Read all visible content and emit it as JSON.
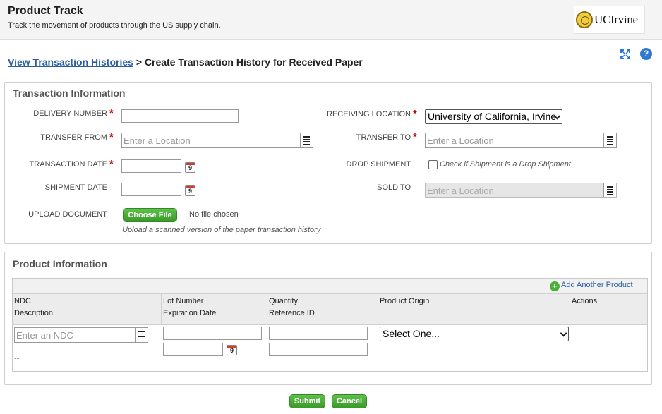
{
  "header": {
    "title": "Product Track",
    "subtitle": "Track the movement of products through the US supply chain.",
    "logo_text": "UCIrvine"
  },
  "breadcrumb": {
    "link": "View Transaction Histories",
    "separator": ">",
    "current": "Create Transaction History for Received Paper"
  },
  "icons": {
    "expand": "expand-icon",
    "help": "?"
  },
  "transaction": {
    "title": "Transaction Information",
    "required_mark": "*",
    "delivery_number": {
      "label": "DELIVERY NUMBER",
      "value": ""
    },
    "transfer_from": {
      "label": "TRANSFER FROM",
      "placeholder": "Enter a Location"
    },
    "transaction_date": {
      "label": "TRANSACTION DATE",
      "value": "",
      "cal_day": "9"
    },
    "shipment_date": {
      "label": "SHIPMENT DATE",
      "value": "",
      "cal_day": "9"
    },
    "upload": {
      "label": "UPLOAD DOCUMENT",
      "button": "Choose File",
      "status": "No file chosen",
      "hint": "Upload a scanned version of the paper transaction history"
    },
    "receiving_location": {
      "label": "RECEIVING LOCATION",
      "value": "University of California, Irvine"
    },
    "transfer_to": {
      "label": "TRANSFER TO",
      "placeholder": "Enter a Location"
    },
    "drop_shipment": {
      "label": "DROP SHIPMENT",
      "checked": false,
      "hint": "Check if Shipment is a Drop Shipment"
    },
    "sold_to": {
      "label": "SOLD TO",
      "placeholder": "Enter a Location",
      "disabled": true
    }
  },
  "product": {
    "title": "Product Information",
    "add_link": "Add Another Product",
    "columns": [
      {
        "line1": "NDC",
        "line2": "Description"
      },
      {
        "line1": "Lot Number",
        "line2": "Expiration Date"
      },
      {
        "line1": "Quantity",
        "line2": "Reference ID"
      },
      {
        "line1": "Product Origin",
        "line2": ""
      },
      {
        "line1": "Actions",
        "line2": ""
      }
    ],
    "row": {
      "ndc_placeholder": "Enter an NDC",
      "description": "--",
      "lot_number": "",
      "expiration_date": "",
      "exp_cal_day": "9",
      "quantity": "",
      "reference_id": "",
      "origin_value": "Select One..."
    }
  },
  "actions": {
    "submit": "Submit",
    "cancel": "Cancel"
  }
}
